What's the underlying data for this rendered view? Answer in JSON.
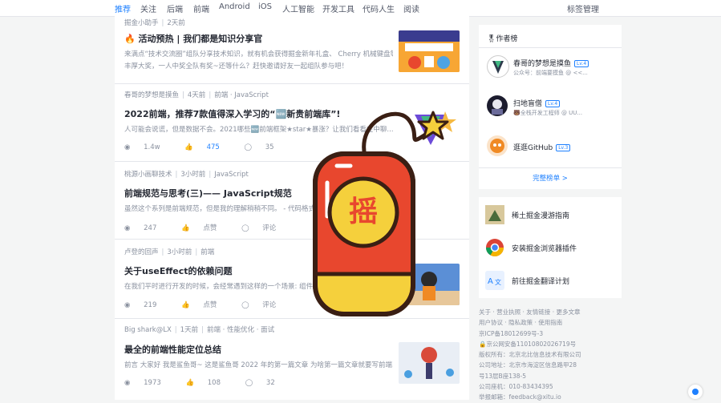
{
  "nav": {
    "tabs": [
      "推荐",
      "关注",
      "后端",
      "前端",
      "Android",
      "iOS",
      "人工智能",
      "开发工具",
      "代码人生",
      "阅读"
    ],
    "active": "推荐",
    "manage": "标签管理"
  },
  "articles": [
    {
      "meta": [
        "掘金小助手",
        "2天前"
      ],
      "title": "🔥 活动预热 | 我们都是知识分享官",
      "abstract": [
        "来满点“技术交流圈”组队分享技术知识，就有机会获得掘金新年礼盒、 Cherry 机械键盘等",
        "丰厚大奖，一人中奖全队有奖~还等什么？赶快邀请好友一起组队参与吧！"
      ]
    },
    {
      "meta": [
        "春哥的梦想是摸鱼",
        "4天前",
        "前端 · JavaScript"
      ],
      "title": "2022前端，推荐7款值得深入学习的“🆕新贵前端库”!",
      "abstract": [
        "人可能会说谎，但是数据不会。2021哪些🆕前端框架★star★暴涨？让我们看看在中聊..."
      ],
      "stats": {
        "views": "1.4w",
        "likes": "475",
        "comments": "35"
      }
    },
    {
      "meta": [
        "桃源小画聊技术",
        "3小时前",
        "JavaScript"
      ],
      "title": "前端规范与思考(三)—— JavaScript规范",
      "abstract": [
        "虽然这个系列是前端规范，但是我的理解稍稍不同。 - 代码格式 · 命名规范 ...节 - 代码..."
      ],
      "stats": {
        "views": "247",
        "likes": "点赞",
        "comments": "评论"
      }
    },
    {
      "meta": [
        "卢登的回声",
        "3小时前",
        "前端"
      ],
      "title": "关于useEffect的依赖问题",
      "abstract": [
        "在我们平时进行开发的时候，会经常遇到这样的一个场景: 组件加载..."
      ],
      "stats": {
        "views": "219",
        "likes": "点赞",
        "comments": "评论"
      }
    },
    {
      "meta": [
        "Big shark@LX",
        "1天前",
        "前端 · 性能优化 · 面试"
      ],
      "title": "最全的前端性能定位总结",
      "abstract": [
        "前言 大家好 我是鲨鱼哥~ 这是鲨鱼哥 2022 年的第一篇文章 为啥第一篇文章就要写前端..."
      ],
      "stats": {
        "views": "1973",
        "likes": "108",
        "comments": "32"
      }
    }
  ],
  "sidebar": {
    "authors_title": "🎖作者榜",
    "authors": [
      {
        "name": "春哥的梦想是摸鱼",
        "level": "Lv.4",
        "desc": "公众号：前端要摸鱼 @ <<..."
      },
      {
        "name": "扫地盲僧",
        "level": "Lv.4",
        "desc": "🐻全栈开发工程师 @ UU..."
      },
      {
        "name": "逛逛GitHub",
        "level": "Lv.3",
        "desc": ""
      }
    ],
    "authors_more": "完整榜单 >",
    "links": [
      "稀土掘金漫游指南",
      "安装掘金浏览器插件",
      "前往掘金翻译计划"
    ]
  },
  "footer": [
    "关于 · 营业执照 · 友情链接 · 更多文章",
    "用户协议 · 隐私政策 · 使用指南",
    "京ICP备18012699号-3",
    "🔒京公网安备11010802026719号",
    "版权所有：北京北比信息技术有限公司",
    "公司地址：北京市海淀区信息路甲28号13层B座138-5",
    "公司座机：010-83434395",
    "举报邮箱：feedback@xitu.io"
  ],
  "overlay": {
    "char": "摇"
  },
  "colors": {
    "accent": "#1e80ff",
    "redpack": "#e8472e",
    "gold": "#f5d03c",
    "outline": "#3a1f14"
  }
}
